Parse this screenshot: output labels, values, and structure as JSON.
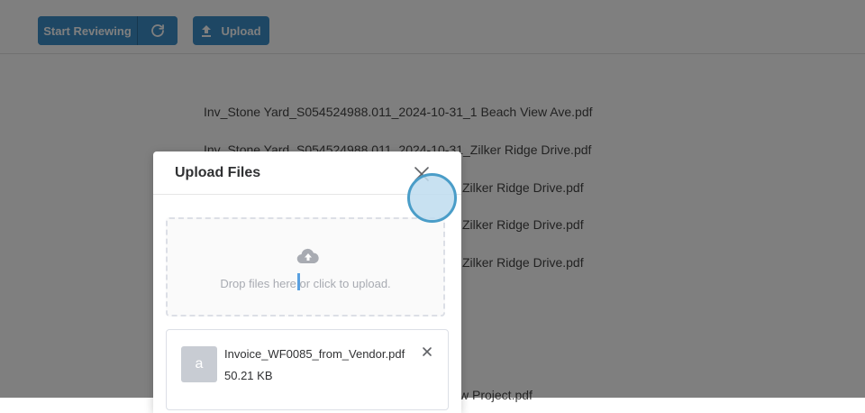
{
  "toolbar": {
    "start_label": "Start Reviewing",
    "upload_label": "Upload",
    "accent": "#3d8ec8"
  },
  "files": [
    "Inv_Stone Yard_S054524988.011_2024-10-31_1 Beach View Ave.pdf",
    "Inv_Stone Yard_S054524988.011_2024-10-31_Zilker Ridge Drive.pdf",
    "Zilker Ridge Drive.pdf",
    "Zilker Ridge Drive.pdf",
    "Zilker Ridge Drive.pdf",
    "w Project.pdf"
  ],
  "modal": {
    "title": "Upload Files",
    "drop_text": "Drop files here or click to upload.",
    "file": {
      "thumb_letter": "a",
      "name": "Invoice_WF0085_from_Vendor.pdf",
      "size": "50.21 KB"
    }
  },
  "icons": {
    "refresh": "refresh-icon",
    "upload": "upload-icon",
    "close": "close-icon",
    "cloud": "cloud-upload-icon",
    "remove": "remove-icon"
  }
}
